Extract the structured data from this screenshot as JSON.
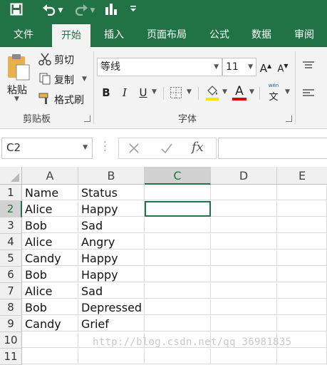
{
  "colors": {
    "brand": "#217346",
    "font_color_red": "#e00000",
    "highlight_yellow": "#ffe000"
  },
  "qat": {
    "icons": [
      "save-icon",
      "undo-icon",
      "redo-icon",
      "chart-icon",
      "customize-icon"
    ]
  },
  "tabs": [
    {
      "label": "文件",
      "active": false
    },
    {
      "label": "开始",
      "active": true
    },
    {
      "label": "插入",
      "active": false
    },
    {
      "label": "页面布局",
      "active": false
    },
    {
      "label": "公式",
      "active": false
    },
    {
      "label": "数据",
      "active": false
    },
    {
      "label": "审阅",
      "active": false
    }
  ],
  "clipboard": {
    "paste": "粘贴",
    "cut": "剪切",
    "copy": "复制",
    "format_painter": "格式刷",
    "group_label": "剪贴板"
  },
  "font": {
    "name": "等线",
    "size": "11",
    "bold": "B",
    "italic": "I",
    "underline": "U",
    "font_color_letter": "A",
    "phonetic_top": "wén",
    "phonetic_char": "文",
    "group_label": "字体"
  },
  "formula_bar": {
    "name_box": "C2",
    "fx": "fx",
    "value": ""
  },
  "columns": [
    "A",
    "B",
    "C",
    "D",
    "E"
  ],
  "rows": [
    {
      "num": "1",
      "a": "Name",
      "b": "Status"
    },
    {
      "num": "2",
      "a": "Alice",
      "b": "Happy"
    },
    {
      "num": "3",
      "a": "Bob",
      "b": "Sad"
    },
    {
      "num": "4",
      "a": "Alice",
      "b": "Angry"
    },
    {
      "num": "5",
      "a": "Candy",
      "b": "Happy"
    },
    {
      "num": "6",
      "a": "Bob",
      "b": "Happy"
    },
    {
      "num": "7",
      "a": "Alice",
      "b": "Sad"
    },
    {
      "num": "8",
      "a": "Bob",
      "b": "Depressed"
    },
    {
      "num": "9",
      "a": "Candy",
      "b": "Grief"
    },
    {
      "num": "10",
      "a": "",
      "b": ""
    },
    {
      "num": "11",
      "a": "",
      "b": ""
    }
  ],
  "watermark": "http://blog.csdn.net/qq_36981835"
}
